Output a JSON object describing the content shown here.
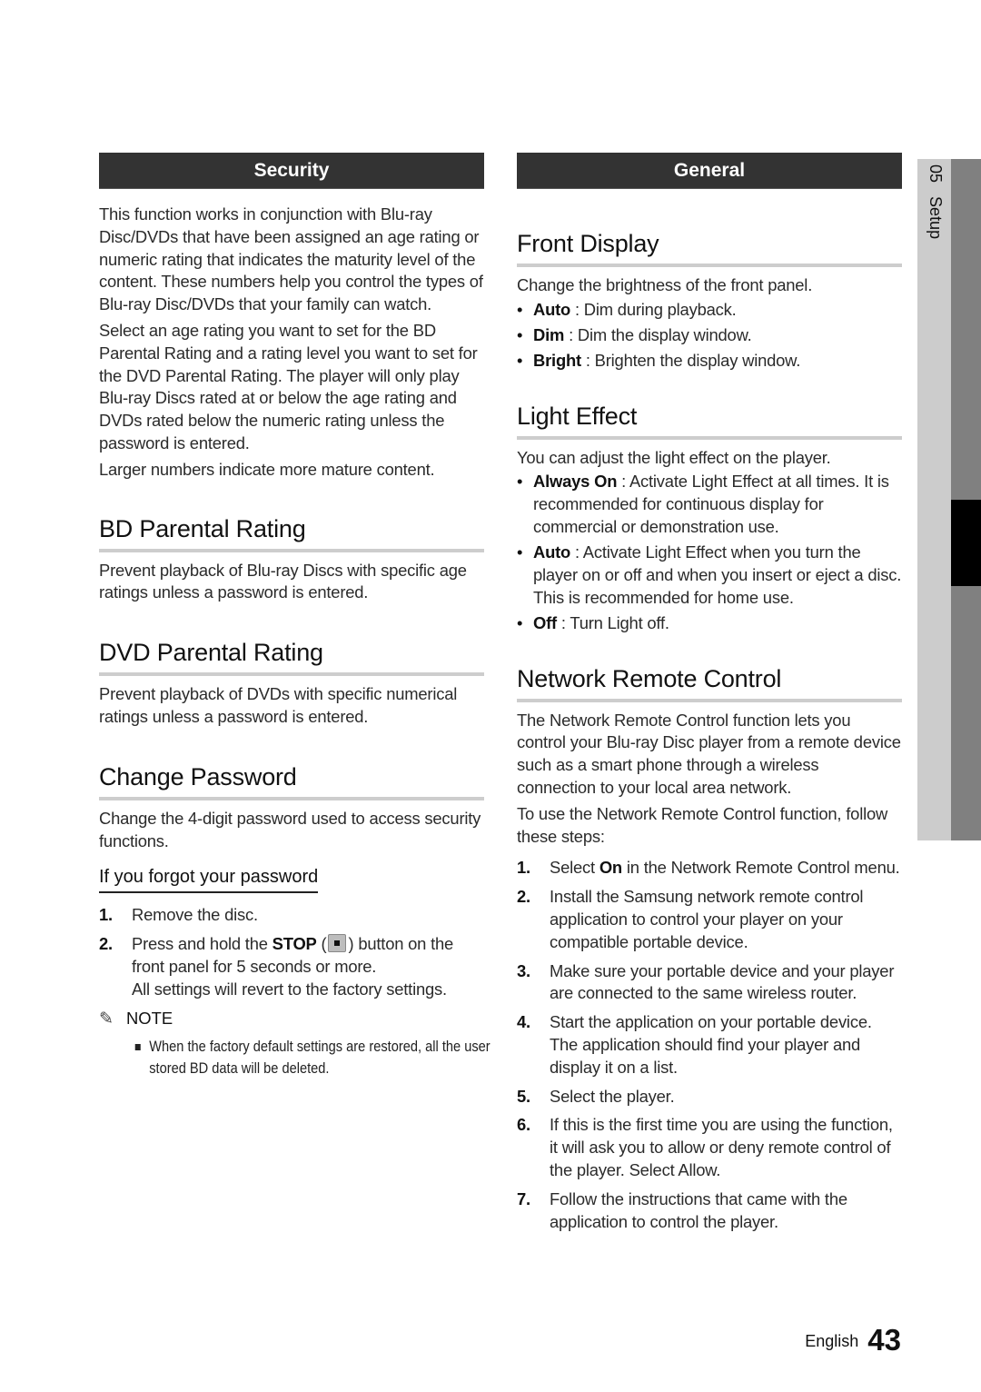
{
  "side_tab": {
    "chapter_number": "05",
    "chapter_title": "Setup"
  },
  "footer": {
    "language": "English",
    "page_number": "43"
  },
  "left": {
    "banner": "Security",
    "intro": [
      "This function works in conjunction with Blu-ray Disc/DVDs that have been assigned an age rating or numeric rating that indicates the maturity level of the content. These numbers help you control the types of Blu-ray Disc/DVDs that your family can watch.",
      "Select an age rating you want to set for the BD Parental Rating and a rating level you want to set for the DVD Parental Rating. The player will only play Blu-ray Discs rated at or below the age rating and DVDs rated below the numeric rating unless the password is entered.",
      "Larger numbers indicate more mature content."
    ],
    "bd": {
      "title": "BD Parental Rating",
      "text": "Prevent playback of Blu-ray Discs with specific age ratings unless a password is entered."
    },
    "dvd": {
      "title": "DVD Parental Rating",
      "text": "Prevent playback of DVDs with specific numerical ratings unless a password is entered."
    },
    "change_password": {
      "title": "Change Password",
      "text": "Change the 4-digit password used to access security functions.",
      "forgot_title": "If you forgot your password",
      "steps": [
        {
          "num": "1.",
          "text": "Remove the disc."
        },
        {
          "num": "2.",
          "pre": "Press and hold the ",
          "bold": "STOP",
          "icon": "stop-button-icon",
          "post": " button on the front panel for 5 seconds or more.",
          "extra": "All settings will revert to the factory settings."
        }
      ],
      "note_label": "NOTE",
      "note_items": [
        "When the factory default settings are restored, all the user stored BD data will be deleted."
      ]
    }
  },
  "right": {
    "banner": "General",
    "front_display": {
      "title": "Front Display",
      "text": "Change the brightness of the front panel.",
      "options": [
        {
          "label": "Auto",
          "desc": " : Dim during playback."
        },
        {
          "label": "Dim",
          "desc": " : Dim the display window."
        },
        {
          "label": "Bright",
          "desc": " : Brighten the display window."
        }
      ]
    },
    "light_effect": {
      "title": "Light Effect",
      "text": "You can adjust the light effect on the player.",
      "options": [
        {
          "label": "Always On",
          "desc": " : Activate Light Effect at all times. It is recommended for continuous display for commercial or demonstration use."
        },
        {
          "label": "Auto",
          "desc": " : Activate Light Effect when you turn the player on or off and when you insert or eject a disc. This is recommended for home use."
        },
        {
          "label": "Off",
          "desc": " : Turn Light off."
        }
      ]
    },
    "network_remote": {
      "title": "Network Remote Control",
      "text1": "The Network Remote Control function lets you control your Blu-ray Disc player from a remote device such as a smart phone through a wireless connection to your local area network.",
      "text2": "To use the Network Remote Control function, follow these steps:",
      "steps": [
        {
          "num": "1.",
          "pre": "Select ",
          "bold": "On",
          "post": " in the Network Remote Control menu."
        },
        {
          "num": "2.",
          "text": "Install the Samsung network remote control application to control your player on your compatible portable device."
        },
        {
          "num": "3.",
          "text": "Make sure your portable device and your player are connected to the same wireless router."
        },
        {
          "num": "4.",
          "text": "Start the application on your portable device. The application should find your player and display it on a list."
        },
        {
          "num": "5.",
          "text": "Select the player."
        },
        {
          "num": "6.",
          "text": "If this is the first time you are using the function, it will ask you to allow or deny remote control of the player. Select Allow."
        },
        {
          "num": "7.",
          "text": "Follow the instructions that came with the application to control the player."
        }
      ]
    }
  }
}
